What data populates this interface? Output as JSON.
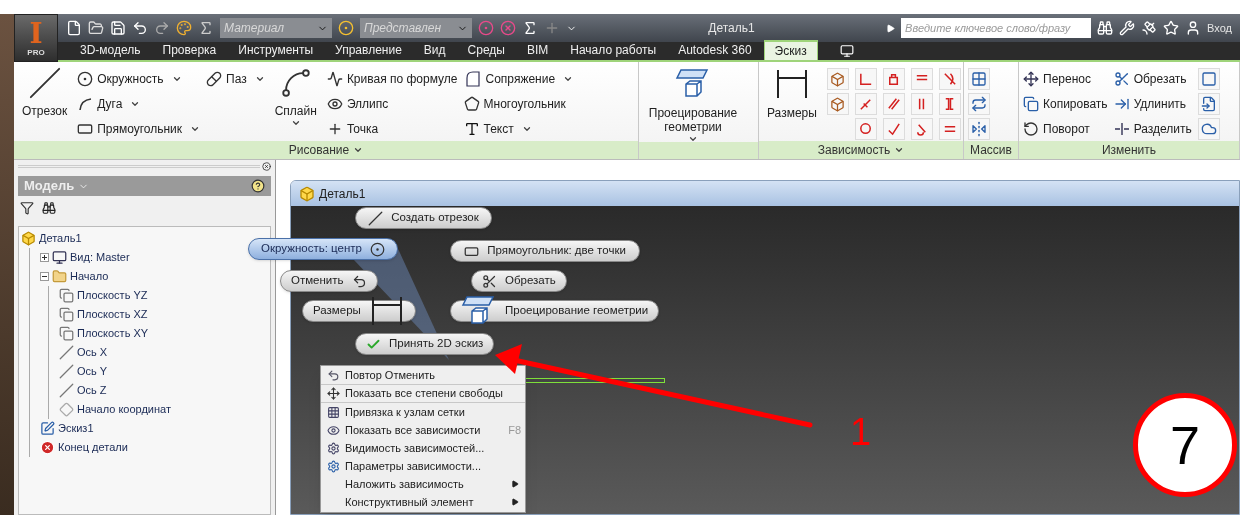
{
  "app_button": {
    "letter": "I",
    "badge": "PRO"
  },
  "quick_access": {
    "material": {
      "placeholder": "Материал"
    },
    "appearance": {
      "placeholder": "Представлен"
    }
  },
  "window": {
    "title": "Деталь1"
  },
  "search": {
    "placeholder": "Введите ключевое слово/фразу"
  },
  "sign_in": "Вход",
  "tabs": [
    {
      "label": "3D-модель",
      "selected": false
    },
    {
      "label": "Проверка",
      "selected": false
    },
    {
      "label": "Инструменты",
      "selected": false
    },
    {
      "label": "Управление",
      "selected": false
    },
    {
      "label": "Вид",
      "selected": false
    },
    {
      "label": "Среды",
      "selected": false
    },
    {
      "label": "BIM",
      "selected": false
    },
    {
      "label": "Начало работы",
      "selected": false
    },
    {
      "label": "Autodesk 360",
      "selected": false
    },
    {
      "label": "Эскиз",
      "selected": true
    }
  ],
  "ribbon": {
    "panels": [
      {
        "title": "Рисование",
        "has_menu": true,
        "columns": [
          [
            {
              "kind": "large",
              "label": "Отрезок",
              "has_menu": false
            }
          ],
          [
            {
              "kind": "small",
              "label": "Окружность",
              "has_menu": true
            },
            {
              "kind": "small",
              "label": "Дуга",
              "has_menu": true
            },
            {
              "kind": "small",
              "label": "Прямоугольник",
              "has_menu": true
            }
          ],
          [
            {
              "kind": "small",
              "label": "Паз",
              "has_menu": true
            }
          ],
          [
            {
              "kind": "large",
              "label": "Сплайн",
              "has_menu": true
            }
          ],
          [
            {
              "kind": "small",
              "label": "Кривая по формуле",
              "has_menu": false
            },
            {
              "kind": "small",
              "label": "Эллипс",
              "has_menu": false
            },
            {
              "kind": "small",
              "label": "Точка",
              "has_menu": false
            }
          ],
          [
            {
              "kind": "small",
              "label": "Сопряжение",
              "has_menu": true
            },
            {
              "kind": "small",
              "label": "Многоугольник",
              "has_menu": false
            },
            {
              "kind": "small",
              "label": "Текст",
              "has_menu": true
            }
          ]
        ]
      },
      {
        "has_menu": false,
        "columns": [
          [
            {
              "kind": "large",
              "label": "Проецирование геометрии",
              "has_menu": true
            }
          ]
        ]
      },
      {
        "title": "Зависимость",
        "has_menu": true,
        "columns": [
          [
            {
              "kind": "large",
              "label": "Размеры",
              "has_menu": false
            }
          ],
          [
            {
              "kind": "icon"
            },
            {
              "kind": "icon"
            }
          ],
          [
            {
              "kind": "icon"
            },
            {
              "kind": "icon"
            },
            {
              "kind": "icon"
            }
          ],
          [
            {
              "kind": "icon"
            },
            {
              "kind": "icon"
            },
            {
              "kind": "icon"
            }
          ],
          [
            {
              "kind": "icon"
            },
            {
              "kind": "icon"
            },
            {
              "kind": "icon"
            }
          ],
          [
            {
              "kind": "icon"
            },
            {
              "kind": "icon"
            },
            {
              "kind": "icon"
            }
          ]
        ]
      },
      {
        "title": "Массив",
        "has_menu": false,
        "columns": [
          [
            {
              "kind": "icon"
            },
            {
              "kind": "icon"
            },
            {
              "kind": "icon"
            }
          ]
        ]
      },
      {
        "title": "Изменить",
        "has_menu": false,
        "columns": [
          [
            {
              "kind": "small",
              "label": "Перенос",
              "has_menu": false
            },
            {
              "kind": "small",
              "label": "Копировать",
              "has_menu": false
            },
            {
              "kind": "small",
              "label": "Поворот",
              "has_menu": false
            }
          ],
          [
            {
              "kind": "small",
              "label": "Обрезать",
              "has_menu": false
            },
            {
              "kind": "small",
              "label": "Удлинить",
              "has_menu": false
            },
            {
              "kind": "small",
              "label": "Разделить",
              "has_menu": false
            }
          ],
          [
            {
              "kind": "icon"
            },
            {
              "kind": "icon"
            },
            {
              "kind": "icon"
            }
          ]
        ]
      }
    ]
  },
  "browser": {
    "title": "Модель",
    "tree": [
      {
        "label": "Деталь1",
        "kind": "part",
        "children": [
          {
            "label": "Вид: Master",
            "kind": "view",
            "expanded": false
          },
          {
            "label": "Начало",
            "kind": "folder",
            "expanded": true,
            "children": [
              {
                "label": "Плоскость YZ",
                "kind": "plane"
              },
              {
                "label": "Плоскость XZ",
                "kind": "plane"
              },
              {
                "label": "Плоскость XY",
                "kind": "plane"
              },
              {
                "label": "Ось X",
                "kind": "axis"
              },
              {
                "label": "Ось Y",
                "kind": "axis"
              },
              {
                "label": "Ось Z",
                "kind": "axis"
              },
              {
                "label": "Начало координат",
                "kind": "point"
              }
            ]
          },
          {
            "label": "Эскиз1",
            "kind": "sketch"
          },
          {
            "label": "Конец детали",
            "kind": "end"
          }
        ]
      }
    ]
  },
  "document": {
    "title": "Деталь1"
  },
  "marking_menu": [
    {
      "label": "Создать отрезок",
      "selected": false
    },
    {
      "label": "Окружность: центр",
      "selected": true
    },
    {
      "label": "Прямоугольник: две точки",
      "selected": false
    },
    {
      "label": "Отменить",
      "selected": false
    },
    {
      "label": "Обрезать",
      "selected": false
    },
    {
      "label": "Размеры",
      "selected": false
    },
    {
      "label": "Проецирование геометрии",
      "selected": false
    },
    {
      "label": "Принять 2D эскиз",
      "selected": false
    }
  ],
  "context_menu": [
    {
      "label": "Повтор Отменить",
      "separator_after": true,
      "submenu": false
    },
    {
      "label": "Показать все степени свободы",
      "separator_after": true,
      "submenu": false
    },
    {
      "label": "Привязка к узлам сетки",
      "separator_after": false,
      "submenu": false
    },
    {
      "label": "Показать все зависимости",
      "shortcut": "F8",
      "separator_after": false,
      "submenu": false
    },
    {
      "label": "Видимость зависимостей...",
      "separator_after": false,
      "submenu": false
    },
    {
      "label": "Параметры зависимости...",
      "separator_after": false,
      "submenu": false
    },
    {
      "label": "Наложить зависимость",
      "separator_after": false,
      "submenu": true
    },
    {
      "label": "Конструктивный элемент",
      "separator_after": false,
      "submenu": true
    }
  ],
  "annotations": {
    "arrow_label": "1",
    "step_badge": "7"
  }
}
